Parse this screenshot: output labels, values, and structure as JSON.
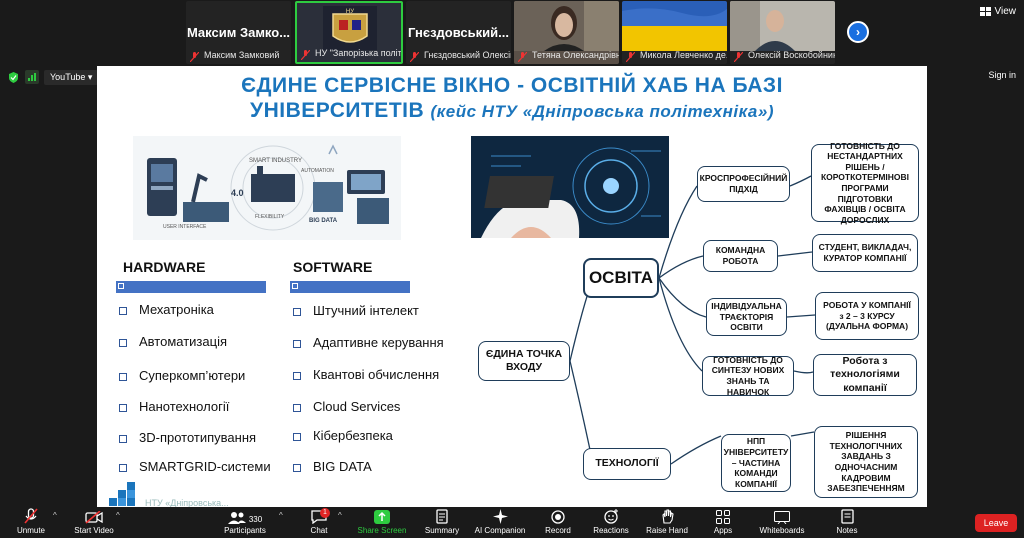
{
  "participants": [
    {
      "big": "Максим  Замко...",
      "caption": "Максим Замковий"
    },
    {
      "big": "",
      "caption": "НУ \"Запорізька політехні..."
    },
    {
      "big": "Гнєздовський...",
      "caption": "Гнєздовський Олексій"
    },
    {
      "big": "",
      "caption": "Тетяна Олександрівна..."
    },
    {
      "big": "",
      "caption": "Микола Левченко  де..."
    },
    {
      "big": "",
      "caption": "Олексій Воскобойник"
    }
  ],
  "view_label": "View",
  "share": {
    "source": "YouTube",
    "signin": "Sign in"
  },
  "slide": {
    "title_line1": "ЄДИНЕ СЕРВІСНЕ ВІКНО - ОСВІТНІЙ ХАБ НА БАЗІ",
    "title_line2": "УНІВЕРСИТЕТІВ",
    "title_case": "(кейс НТУ «Дніпровська політехніка»)",
    "hardware_head": "HARDWARE",
    "software_head": "SOFTWARE",
    "hardware": [
      "Мехатроніка",
      "Автоматизація",
      "Суперкомп’ютери",
      "Нанотехнології",
      "3D-прототипування",
      "SMARTGRID-системи"
    ],
    "software": [
      "Штучний інтелект",
      "Адаптивне керування",
      "Квантові обчислення",
      "Cloud Services",
      "Кібербезпека",
      "BIG DATA"
    ],
    "image_labels": {
      "smart": "SMART INDUSTRY",
      "auto": "AUTOMATION",
      "ui": "USER INTERFACE",
      "i40": "4.0",
      "flex": "FLEXIBILITY",
      "bigdata": "BIG DATA"
    },
    "logo_text": "НТУ «Дніпровська...",
    "root": "ЄДИНА ТОЧКА ВХОДУ",
    "osvita": "ОСВІТА",
    "tekhnologii": "ТЕХНОЛОГІЇ",
    "mid": [
      "КРОСПРОФЕСІЙНИЙ ПІДХІД",
      "КОМАНДНА РОБОТА",
      "ІНДИВІДУАЛЬНА ТРАЄКТОРІЯ ОСВІТИ",
      "ГОТОВНІСТЬ ДО СИНТЕЗУ НОВИХ ЗНАНЬ ТА НАВИЧОК",
      "НПП УНІВЕРСИТЕТУ – ЧАСТИНА КОМАНДИ КОМПАНІЇ"
    ],
    "right": [
      "ГОТОВНІСТЬ ДО НЕСТАНДАРТНИХ РІШЕНЬ / КОРОТКОТЕРМІНОВІ ПРОГРАМИ ПІДГОТОВКИ ФАХІВЦІВ / ОСВІТА ДОРОСЛИХ",
      "СТУДЕНТ, ВИКЛАДАЧ, КУРАТОР КОМПАНІЇ",
      "РОБОТА У КОМПАНІЇ з 2 – 3 КУРСУ (ДУАЛЬНА ФОРМА)",
      "Робота з технологіями компанії",
      "РІШЕННЯ ТЕХНОЛОГІЧНИХ ЗАВДАНЬ З ОДНОЧАСНИМ КАДРОВИМ ЗАБЕЗПЕЧЕННЯМ"
    ]
  },
  "toolbar": {
    "unmute": "Unmute",
    "start_video": "Start Video",
    "participants": "Participants",
    "participants_count": "330",
    "chat": "Chat",
    "chat_badge": "1",
    "share_screen": "Share Screen",
    "summary": "Summary",
    "ai": "AI Companion",
    "record": "Record",
    "reactions": "Reactions",
    "raise": "Raise Hand",
    "apps": "Apps",
    "whiteboards": "Whiteboards",
    "notes": "Notes",
    "leave": "Leave"
  },
  "colors": {
    "accent": "#1b75bc",
    "share_green": "#2ecc40",
    "leave_red": "#dd2222",
    "bar_blue": "#4472c4"
  }
}
